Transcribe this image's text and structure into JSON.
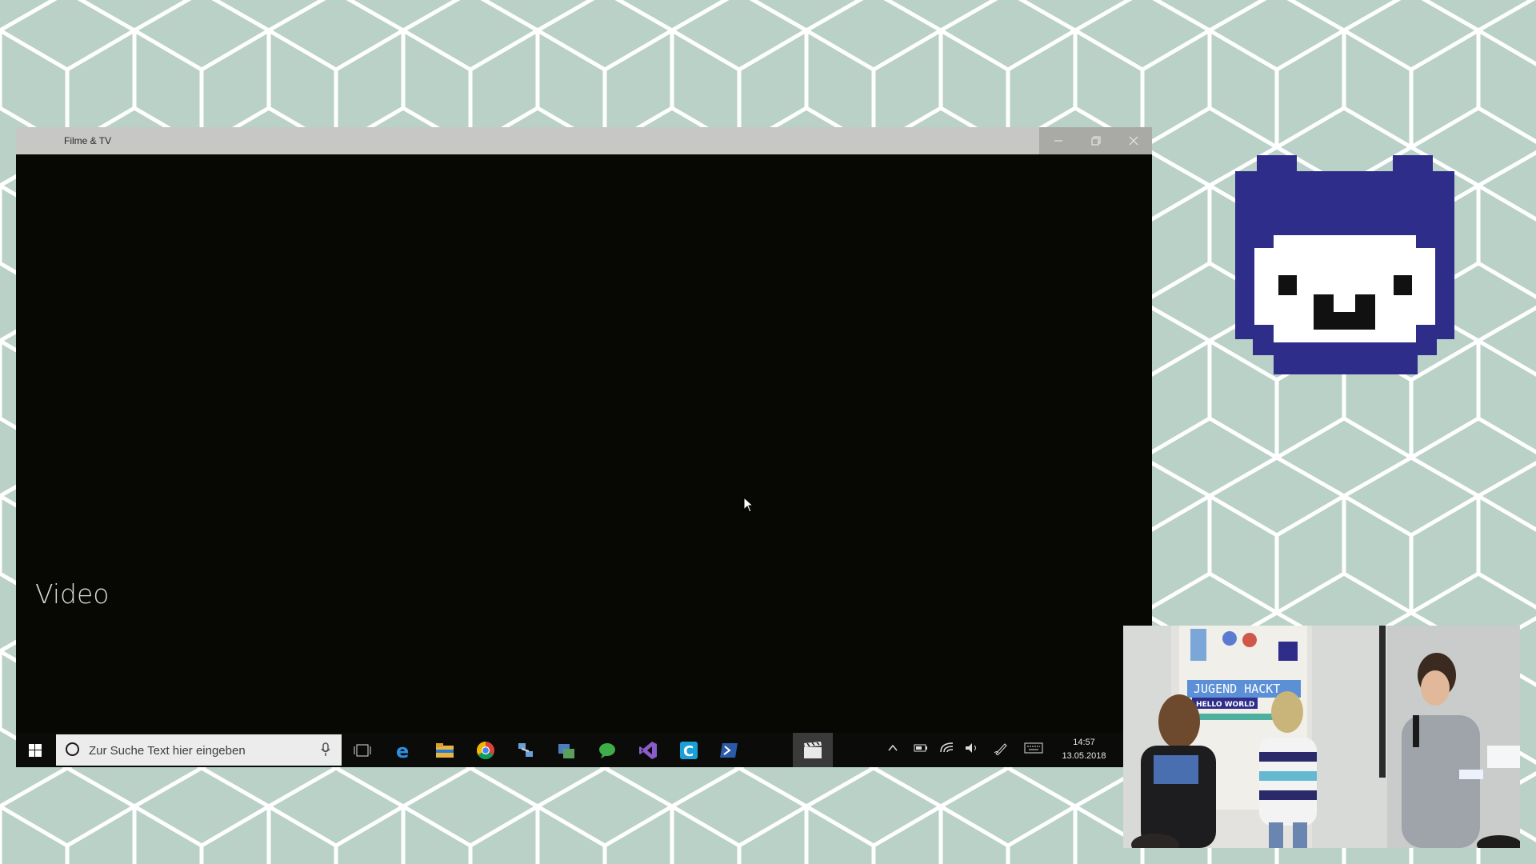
{
  "window": {
    "title": "Filme & TV",
    "minimize_icon": "minimize-icon",
    "restore_icon": "restore-icon",
    "close_icon": "close-icon",
    "content_label": "Video"
  },
  "taskbar": {
    "search_placeholder": "Zur Suche Text hier eingeben",
    "time": "14:57",
    "date": "13.05.2018",
    "apps": [
      "task-view-icon",
      "edge-icon",
      "file-explorer-icon",
      "chrome-icon",
      "network-app-icon",
      "store-app-icon",
      "chat-app-icon",
      "visual-studio-icon",
      "c-app-icon",
      "powershell-icon",
      "movies-tv-icon"
    ],
    "tray": [
      "chevron-up-icon",
      "battery-icon",
      "wifi-icon",
      "volume-icon",
      "pen-icon",
      "keyboard-icon"
    ]
  },
  "colors": {
    "background": "#b9d1c7",
    "mascot_blue": "#2e2d8a",
    "window_bg": "#070703"
  },
  "camera": {
    "banner_text": "JUGEND HACKT",
    "banner_subtext": "HELLO WORLD"
  }
}
